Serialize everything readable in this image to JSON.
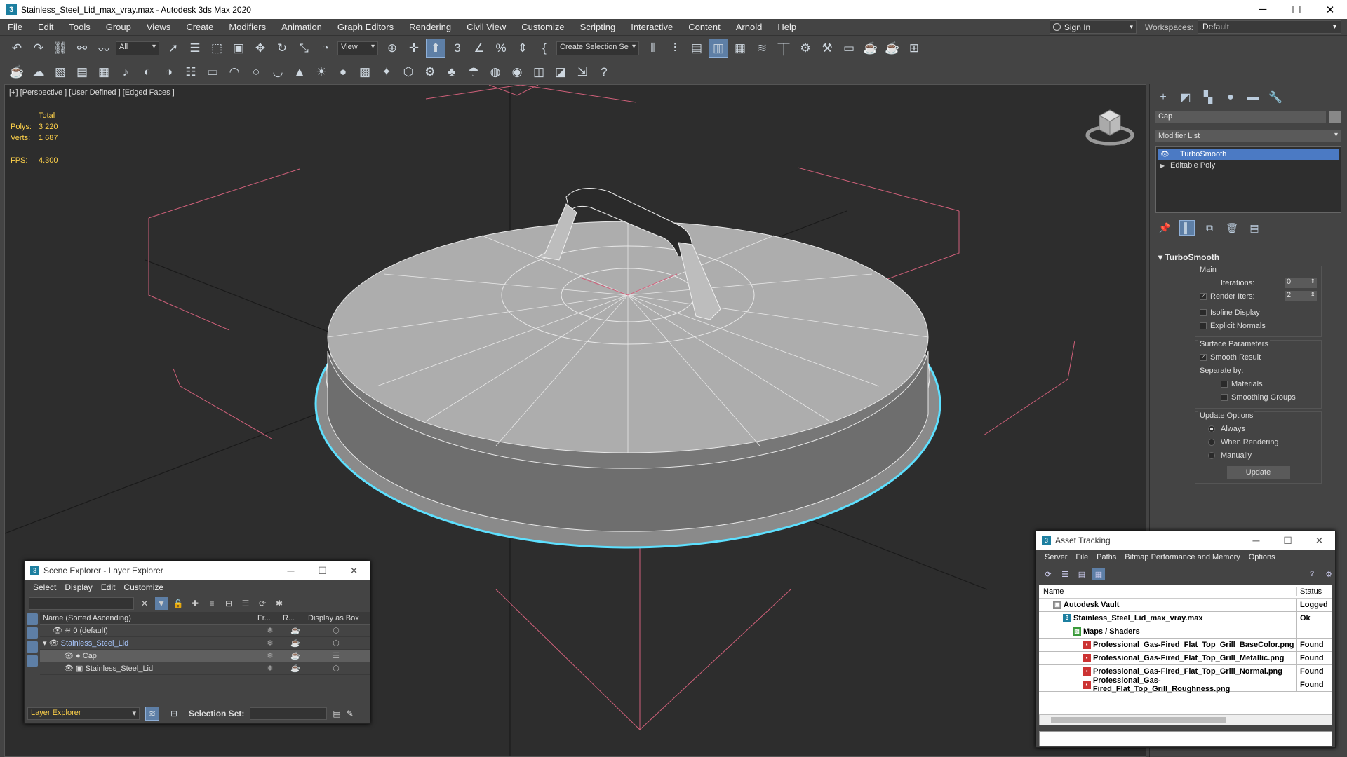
{
  "window": {
    "title": "Stainless_Steel_Lid_max_vray.max - Autodesk 3ds Max 2020",
    "app_icon": "3"
  },
  "menu": [
    "File",
    "Edit",
    "Tools",
    "Group",
    "Views",
    "Create",
    "Modifiers",
    "Animation",
    "Graph Editors",
    "Rendering",
    "Civil View",
    "Customize",
    "Scripting",
    "Interactive",
    "Content",
    "Arnold",
    "Help"
  ],
  "signin": {
    "label": "Sign In"
  },
  "workspaces": {
    "label": "Workspaces:",
    "value": "Default"
  },
  "toolbar": {
    "filter": "All",
    "refcoord": "View",
    "selset": "Create Selection Se"
  },
  "viewport": {
    "label": "[+] [Perspective ] [User Defined ] [Edged Faces ]",
    "stats": {
      "header": "Total",
      "polys_label": "Polys:",
      "polys": "3 220",
      "verts_label": "Verts:",
      "verts": "1 687",
      "fps_label": "FPS:",
      "fps": "4.300"
    }
  },
  "command_panel": {
    "object_name": "Cap",
    "modifier_list": "Modifier List",
    "stack": [
      {
        "label": "TurboSmooth"
      },
      {
        "label": "Editable Poly"
      }
    ],
    "rollout": {
      "title": "TurboSmooth",
      "main": "Main",
      "iterations_label": "Iterations:",
      "iterations": "0",
      "render_iters_label": "Render Iters:",
      "render_iters": "2",
      "isoline": "Isoline Display",
      "explicit": "Explicit Normals",
      "surface_params": "Surface Parameters",
      "smooth_result": "Smooth Result",
      "separate_by": "Separate by:",
      "materials": "Materials",
      "smoothing_groups": "Smoothing Groups",
      "update_options": "Update Options",
      "always": "Always",
      "when_rendering": "When Rendering",
      "manually": "Manually",
      "update_btn": "Update"
    }
  },
  "scene_explorer": {
    "title": "Scene Explorer - Layer Explorer",
    "menu": [
      "Select",
      "Display",
      "Edit",
      "Customize"
    ],
    "columns": {
      "name": "Name (Sorted Ascending)",
      "fr": "Fr...",
      "r": "R...",
      "box": "Display as Box"
    },
    "rows": [
      {
        "label": "0 (default)",
        "indent": 1
      },
      {
        "label": "Stainless_Steel_Lid",
        "indent": 0
      },
      {
        "label": "Cap",
        "indent": 2
      },
      {
        "label": "Stainless_Steel_Lid",
        "indent": 2
      }
    ],
    "footer": {
      "explorer": "Layer Explorer",
      "selset_label": "Selection Set:"
    }
  },
  "asset_tracking": {
    "title": "Asset Tracking",
    "menu": [
      "Server",
      "File",
      "Paths",
      "Bitmap Performance and Memory",
      "Options"
    ],
    "columns": {
      "name": "Name",
      "status": "Status"
    },
    "rows": [
      {
        "name": "Autodesk Vault",
        "status": "Logged",
        "indent": 20
      },
      {
        "name": "Stainless_Steel_Lid_max_vray.max",
        "status": "Ok",
        "indent": 34
      },
      {
        "name": "Maps / Shaders",
        "status": "",
        "indent": 48
      },
      {
        "name": "Professional_Gas-Fired_Flat_Top_Grill_BaseColor.png",
        "status": "Found",
        "indent": 62
      },
      {
        "name": "Professional_Gas-Fired_Flat_Top_Grill_Metallic.png",
        "status": "Found",
        "indent": 62
      },
      {
        "name": "Professional_Gas-Fired_Flat_Top_Grill_Normal.png",
        "status": "Found",
        "indent": 62
      },
      {
        "name": "Professional_Gas-Fired_Flat_Top_Grill_Roughness.png",
        "status": "Found",
        "indent": 62
      }
    ]
  },
  "colors": {
    "selection": "#5de0ff",
    "stats": "#ffd24a",
    "highlight": "#4b7ac4"
  }
}
